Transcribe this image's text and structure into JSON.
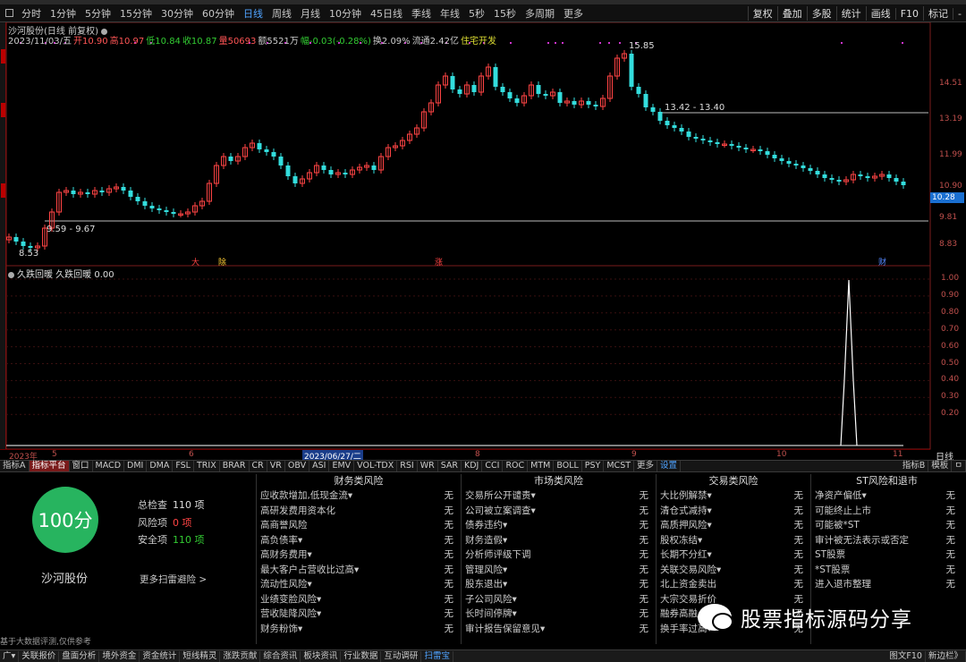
{
  "period_bar": {
    "items": [
      "分时",
      "1分钟",
      "5分钟",
      "15分钟",
      "30分钟",
      "60分钟",
      "日线",
      "周线",
      "月线",
      "10分钟",
      "45日线",
      "季线",
      "年线",
      "5秒",
      "15秒",
      "多周期",
      "更多"
    ],
    "active": "日线",
    "right_items": [
      "复权",
      "叠加",
      "多股",
      "统计",
      "画线",
      "F10",
      "标记",
      "-"
    ]
  },
  "main_chart": {
    "title": "沙河股份(日线 前复权)",
    "info": [
      {
        "label": "2023/11/03/五",
        "color": "#cccccc"
      },
      {
        "label": "开10.90",
        "color": "#ff5555"
      },
      {
        "label": "高10.97",
        "color": "#ff5555"
      },
      {
        "label": "低10.84",
        "color": "#33cc33"
      },
      {
        "label": "收10.87",
        "color": "#33cc33"
      },
      {
        "label": "量50693",
        "color": "#ff5555"
      },
      {
        "label": "额5521万",
        "color": "#cccccc"
      },
      {
        "label": "幅-0.03(-0.28%)",
        "color": "#33cc33"
      },
      {
        "label": "换2.09%",
        "color": "#cccccc"
      },
      {
        "label": "流通2.42亿",
        "color": "#cccccc"
      },
      {
        "label": "住宅开发",
        "color": "#dddd33"
      }
    ],
    "y_ticks": [
      "14.51",
      "13.19",
      "11.99",
      "10.90",
      "9.81",
      "8.83"
    ],
    "current_price": "10.28",
    "annotations": {
      "high": "15.85",
      "low": "8.53",
      "band_upper": "13.42 - 13.40",
      "band_lower": "9.59 - 9.67"
    },
    "event_tags": [
      {
        "text": "大",
        "color": "#ff4444"
      },
      {
        "text": "除",
        "color": "#ffcc33"
      },
      {
        "text": "涨",
        "color": "#ff4444"
      },
      {
        "text": "财",
        "color": "#5588ff"
      }
    ]
  },
  "indicator": {
    "title": "久跌回暖 久跌回暖 0.00",
    "y_ticks": [
      "1.00",
      "0.90",
      "0.80",
      "0.70",
      "0.60",
      "0.50",
      "0.40",
      "0.30",
      "0.20"
    ]
  },
  "date_axis": {
    "labels": [
      "2023年",
      "5",
      "6",
      "2023/06/27/二",
      "8",
      "9",
      "10",
      "11"
    ],
    "highlight": "2023/06/27/二",
    "right_label": "日线"
  },
  "indicator_tabs": {
    "items": [
      "指标A",
      "指标平台",
      "窗口",
      "MACD",
      "DMI",
      "DMA",
      "FSL",
      "TRIX",
      "BRAR",
      "CR",
      "VR",
      "OBV",
      "ASI",
      "EMV",
      "VOL-TDX",
      "RSI",
      "WR",
      "SAR",
      "KDJ",
      "CCI",
      "ROC",
      "MTM",
      "BOLL",
      "PSY",
      "MCST",
      "更多",
      "设置"
    ],
    "active": "指标平台",
    "blue": "设置",
    "right_items": [
      "指标B",
      "模板",
      "ㅁ"
    ]
  },
  "scan": {
    "score": "100分",
    "stock_name": "沙河股份",
    "total_label": "总检查",
    "total_value": "110 项",
    "risk_label": "风险项",
    "risk_value": "0 项",
    "safe_label": "安全项",
    "safe_value": "110 项",
    "more_link": "更多扫雷避险 >",
    "footnote": "基于大数据评测,仅供参考",
    "columns": [
      {
        "title": "财务类风险",
        "rows": [
          {
            "k": "应收款增加,低现金流▾",
            "v": "无"
          },
          {
            "k": "高研发费用资本化",
            "v": "无"
          },
          {
            "k": "高商誉风险",
            "v": "无"
          },
          {
            "k": "高负债率▾",
            "v": "无"
          },
          {
            "k": "高财务费用▾",
            "v": "无"
          },
          {
            "k": "最大客户占营收比过高▾",
            "v": "无"
          },
          {
            "k": "流动性风险▾",
            "v": "无"
          },
          {
            "k": "业绩变脸风险▾",
            "v": "无"
          },
          {
            "k": "营收陡降风险▾",
            "v": "无"
          },
          {
            "k": "财务粉饰▾",
            "v": "无"
          }
        ]
      },
      {
        "title": "市场类风险",
        "rows": [
          {
            "k": "交易所公开谴责▾",
            "v": "无"
          },
          {
            "k": "公司被立案调查▾",
            "v": "无"
          },
          {
            "k": "债券违约▾",
            "v": "无"
          },
          {
            "k": "财务造假▾",
            "v": "无"
          },
          {
            "k": "分析师评级下调",
            "v": "无"
          },
          {
            "k": "管理风险▾",
            "v": "无"
          },
          {
            "k": "股东退出▾",
            "v": "无"
          },
          {
            "k": "子公司风险▾",
            "v": "无"
          },
          {
            "k": "长时间停牌▾",
            "v": "无"
          },
          {
            "k": "审计报告保留意见▾",
            "v": "无"
          }
        ]
      },
      {
        "title": "交易类风险",
        "rows": [
          {
            "k": "大比例解禁▾",
            "v": "无"
          },
          {
            "k": "清仓式减持▾",
            "v": "无"
          },
          {
            "k": "高质押风险▾",
            "v": "无"
          },
          {
            "k": "股权冻结▾",
            "v": "无"
          },
          {
            "k": "长期不分红▾",
            "v": "无"
          },
          {
            "k": "关联交易风险▾",
            "v": "无"
          },
          {
            "k": "北上资金卖出",
            "v": "无"
          },
          {
            "k": "大宗交易折价",
            "v": "无"
          },
          {
            "k": "融券高融",
            "v": "无"
          },
          {
            "k": "换手率过高▾",
            "v": "无"
          }
        ]
      },
      {
        "title": "ST风险和退市",
        "rows": [
          {
            "k": "净资产偏低▾",
            "v": "无"
          },
          {
            "k": "可能终止上市",
            "v": "无"
          },
          {
            "k": "可能被*ST",
            "v": "无"
          },
          {
            "k": "审计被无法表示或否定",
            "v": "无"
          },
          {
            "k": "ST股票",
            "v": "无"
          },
          {
            "k": "*ST股票",
            "v": "无"
          },
          {
            "k": "进入退市整理",
            "v": "无"
          }
        ]
      }
    ]
  },
  "watermark": "股票指标源码分享",
  "bottom_tabs": {
    "items": [
      "广▾",
      "关联报价",
      "盘面分析",
      "境外资金",
      "资金统计",
      "短线精灵",
      "涨跌贡献",
      "综合资讯",
      "板块资讯",
      "行业数据",
      "互动调研",
      "扫雷宝"
    ],
    "active": "扫雷宝",
    "right_items": [
      "图文F10",
      "新边栏》"
    ]
  }
}
